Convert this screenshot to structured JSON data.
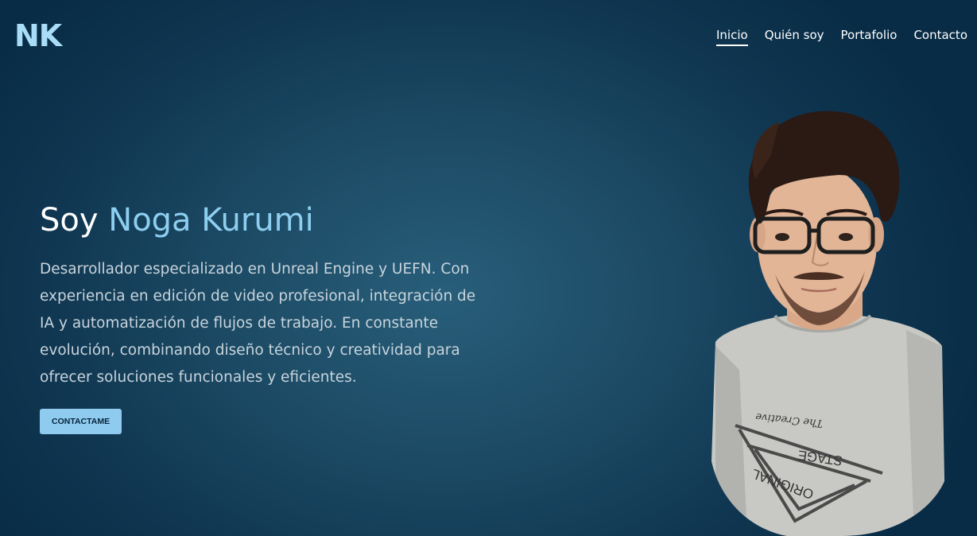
{
  "header": {
    "logo": "NK",
    "nav": [
      {
        "label": "Inicio",
        "active": true
      },
      {
        "label": "Quién soy",
        "active": false
      },
      {
        "label": "Portafolio",
        "active": false
      },
      {
        "label": "Contacto",
        "active": false
      }
    ]
  },
  "hero": {
    "greeting": "Soy",
    "name": "Noga Kurumi",
    "description": "Desarrollador especializado en Unreal Engine y UEFN. Con experiencia en edición de video profesional, integración de IA y automatización de flujos de trabajo. En constante evolución, combinando diseño técnico y creatividad para ofrecer soluciones funcionales y eficientes.",
    "cta_label": "CONTACTAME"
  },
  "portrait": {
    "shirt_text_line1": "The Creative",
    "shirt_text_line2": "STAGE",
    "shirt_text_line3": "ORIGINAL"
  },
  "colors": {
    "accent": "#8ecff0",
    "background_dark": "#082c45",
    "background_light": "#285e7a",
    "button": "#8ecbee"
  }
}
